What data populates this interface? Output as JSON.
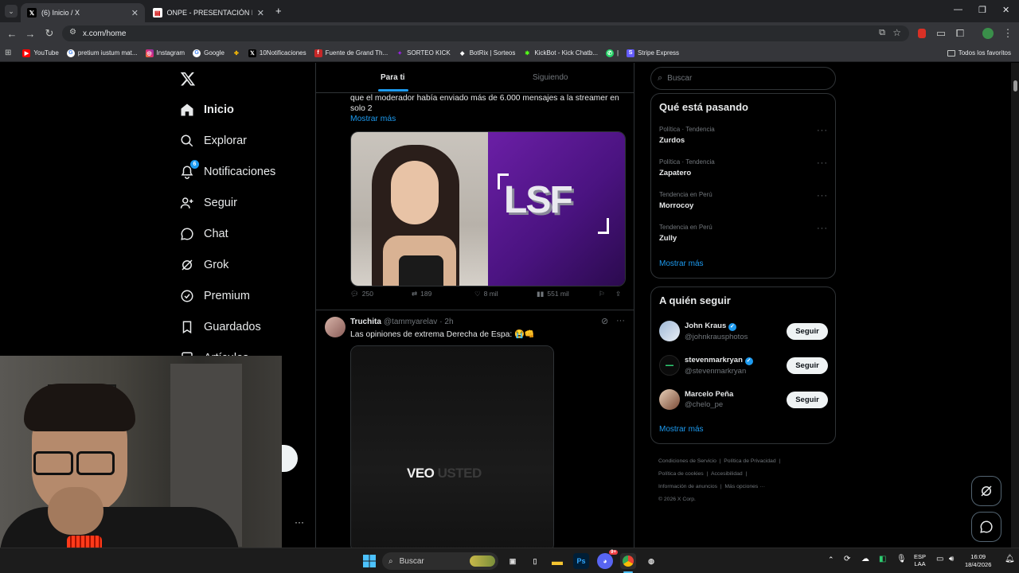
{
  "browser": {
    "tabs": [
      {
        "title": "(6) Inicio / X",
        "active": true
      },
      {
        "title": "ONPE - PRESENTACIÓN DE RES",
        "active": false
      }
    ],
    "url": "x.com/home",
    "bookmarks": [
      "YouTube",
      "pretium iustum mat...",
      "Instagram",
      "Google",
      "10Notificaciones",
      "Fuente de Grand Th...",
      "SORTEO KICK",
      "BotRix | Sorteos",
      "KickBot - Kick Chatb...",
      "|",
      "Stripe Express"
    ],
    "all_bookmarks": "Todos los favoritos"
  },
  "sidebar": {
    "items": [
      {
        "label": "Inicio",
        "icon": "home-icon"
      },
      {
        "label": "Explorar",
        "icon": "search-icon"
      },
      {
        "label": "Notificaciones",
        "icon": "bell-icon",
        "badge": "6"
      },
      {
        "label": "Seguir",
        "icon": "person-plus-icon"
      },
      {
        "label": "Chat",
        "icon": "chat-icon"
      },
      {
        "label": "Grok",
        "icon": "grok-icon"
      },
      {
        "label": "Premium",
        "icon": "verified-icon"
      },
      {
        "label": "Guardados",
        "icon": "bookmark-icon"
      },
      {
        "label": "Artículos",
        "icon": "article-icon"
      }
    ]
  },
  "feed": {
    "tabs": [
      "Para ti",
      "Siguiendo"
    ],
    "post1": {
      "text": "que el moderador había enviado más de 6.000 mensajes a la streamer en solo 2",
      "show_more": "Mostrar más",
      "image_logo": "LSF",
      "replies": "250",
      "reposts": "189",
      "likes": "8 mil",
      "views": "551 mil"
    },
    "post2": {
      "name": "Truchita",
      "handle": "@tammyarelav",
      "time": "· 2h",
      "text": "Las opiniones de extrema Derecha de Espa: 😭👊",
      "video_text_1": "VEO",
      "video_text_2": "USTED"
    }
  },
  "right": {
    "search_placeholder": "Buscar",
    "trending_title": "Qué está pasando",
    "trends": [
      {
        "category": "Política · Tendencia",
        "name": "Zurdos"
      },
      {
        "category": "Política · Tendencia",
        "name": "Zapatero"
      },
      {
        "category": "Tendencia en Perú",
        "name": "Morrocoy"
      },
      {
        "category": "Tendencia en Perú",
        "name": "Zully"
      }
    ],
    "show_more": "Mostrar más",
    "follow_title": "A quién seguir",
    "follow": [
      {
        "name": "John Kraus",
        "handle": "@johnkrausphotos",
        "verified": true,
        "button": "Seguir"
      },
      {
        "name": "stevenmarkryan",
        "handle": "@stevenmarkryan",
        "verified": true,
        "button": "Seguir"
      },
      {
        "name": "Marcelo Peña",
        "handle": "@chelo_pe",
        "verified": false,
        "button": "Seguir"
      }
    ],
    "footer": [
      "Condiciones de Servicio",
      "|",
      "Política de Privacidad",
      "|",
      "Política de cookies",
      "|",
      "Accesibilidad",
      "|",
      "Información de anuncios",
      "|",
      "Más opciones ···",
      "© 2026 X Corp."
    ]
  },
  "taskbar": {
    "search": "Buscar",
    "lang": "ESP",
    "lang2": "LAA",
    "time": "16:09",
    "date": "18/4/2026",
    "discord_badge": "9+"
  },
  "colors": {
    "accent": "#1d9bf0",
    "bg": "#000000",
    "border": "#2f3336"
  }
}
